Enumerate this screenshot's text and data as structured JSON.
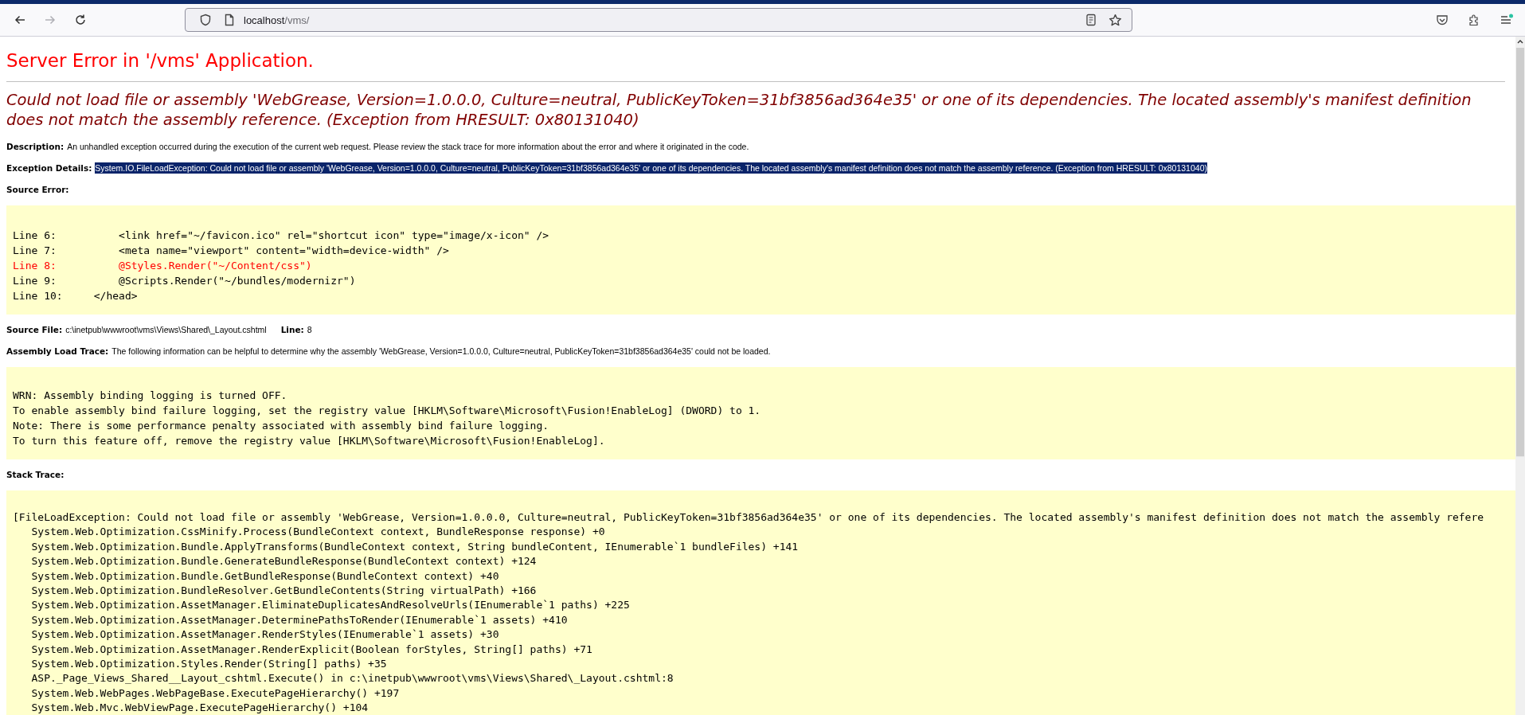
{
  "browser": {
    "back_disabled": false,
    "forward_disabled": true,
    "url": {
      "host": "localhost",
      "path": "/vms/"
    }
  },
  "page": {
    "title": "Server Error in '/vms' Application.",
    "error_message": "Could not load file or assembly 'WebGrease, Version=1.0.0.0, Culture=neutral, PublicKeyToken=31bf3856ad364e35' or one of its dependencies. The located assembly's manifest definition does not match the assembly reference. (Exception from HRESULT: 0x80131040)",
    "description": {
      "label": "Description:",
      "text": "An unhandled exception occurred during the execution of the current web request. Please review the stack trace for more information about the error and where it originated in the code."
    },
    "exception_details": {
      "label": "Exception Details:",
      "text": "System.IO.FileLoadException: Could not load file or assembly 'WebGrease, Version=1.0.0.0, Culture=neutral, PublicKeyToken=31bf3856ad364e35' or one of its dependencies. The located assembly's manifest definition does not match the assembly reference. (Exception from HRESULT: 0x80131040)",
      "selected": true
    },
    "source_error": {
      "label": "Source Error:",
      "lines": [
        {
          "text": "Line 6:          <link href=\"~/favicon.ico\" rel=\"shortcut icon\" type=\"image/x-icon\" />",
          "highlighted": false
        },
        {
          "text": "Line 7:          <meta name=\"viewport\" content=\"width=device-width\" />",
          "highlighted": false
        },
        {
          "text": "Line 8:          @Styles.Render(\"~/Content/css\")",
          "highlighted": true
        },
        {
          "text": "Line 9:          @Scripts.Render(\"~/bundles/modernizr\")",
          "highlighted": false
        },
        {
          "text": "Line 10:     </head>",
          "highlighted": false
        }
      ]
    },
    "source_file": {
      "label": "Source File:",
      "path": "c:\\inetpub\\wwwroot\\vms\\Views\\Shared\\_Layout.cshtml",
      "line_label": "Line:",
      "line": "8"
    },
    "assembly_load_trace": {
      "label": "Assembly Load Trace:",
      "text": "The following information can be helpful to determine why the assembly 'WebGrease, Version=1.0.0.0, Culture=neutral, PublicKeyToken=31bf3856ad364e35' could not be loaded.",
      "lines": [
        "WRN: Assembly binding logging is turned OFF.",
        "To enable assembly bind failure logging, set the registry value [HKLM\\Software\\Microsoft\\Fusion!EnableLog] (DWORD) to 1.",
        "Note: There is some performance penalty associated with assembly bind failure logging.",
        "To turn this feature off, remove the registry value [HKLM\\Software\\Microsoft\\Fusion!EnableLog]."
      ]
    },
    "stack_trace": {
      "label": "Stack Trace:",
      "lines": [
        "[FileLoadException: Could not load file or assembly 'WebGrease, Version=1.0.0.0, Culture=neutral, PublicKeyToken=31bf3856ad364e35' or one of its dependencies. The located assembly's manifest definition does not match the assembly refere",
        "   System.Web.Optimization.CssMinify.Process(BundleContext context, BundleResponse response) +0",
        "   System.Web.Optimization.Bundle.ApplyTransforms(BundleContext context, String bundleContent, IEnumerable`1 bundleFiles) +141",
        "   System.Web.Optimization.Bundle.GenerateBundleResponse(BundleContext context) +124",
        "   System.Web.Optimization.Bundle.GetBundleResponse(BundleContext context) +40",
        "   System.Web.Optimization.BundleResolver.GetBundleContents(String virtualPath) +166",
        "   System.Web.Optimization.AssetManager.EliminateDuplicatesAndResolveUrls(IEnumerable`1 paths) +225",
        "   System.Web.Optimization.AssetManager.DeterminePathsToRender(IEnumerable`1 assets) +410",
        "   System.Web.Optimization.AssetManager.RenderStyles(IEnumerable`1 assets) +30",
        "   System.Web.Optimization.AssetManager.RenderExplicit(Boolean forStyles, String[] paths) +71",
        "   System.Web.Optimization.Styles.Render(String[] paths) +35",
        "   ASP._Page_Views_Shared__Layout_cshtml.Execute() in c:\\inetpub\\wwwroot\\vms\\Views\\Shared\\_Layout.cshtml:8",
        "   System.Web.WebPages.WebPageBase.ExecutePageHierarchy() +197",
        "   System.Web.Mvc.WebViewPage.ExecutePageHierarchy() +104"
      ]
    }
  }
}
